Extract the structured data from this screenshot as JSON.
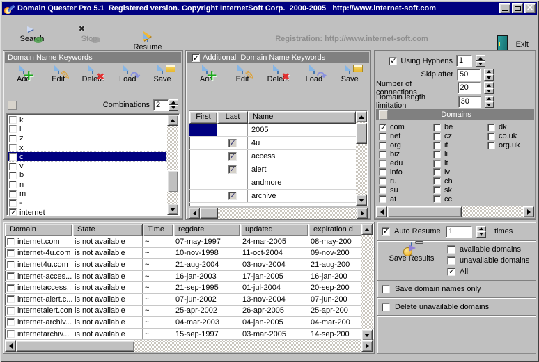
{
  "titlebar": {
    "title": "Domain Quester Pro 5.1  Registered version. Copyright InternetSoft Corp.  2000-2005   http://www.internet-soft.com"
  },
  "toolbar": {
    "search": "Search",
    "stop": "Stop",
    "resume": "Resume",
    "registration": "Registration: http://www.internet-soft.com",
    "exit": "Exit"
  },
  "keywords_panel": {
    "title": "Domain Name Keywords",
    "buttons": [
      {
        "label": "Add",
        "icon": "add-icon"
      },
      {
        "label": "Edit",
        "icon": "edit-icon"
      },
      {
        "label": "Delete",
        "icon": "delete-icon"
      },
      {
        "label": "Load",
        "icon": "load-icon"
      },
      {
        "label": "Save",
        "icon": "save-icon"
      }
    ],
    "combinations_label": "Combinations",
    "combinations_value": "2",
    "items": [
      {
        "label": "k"
      },
      {
        "label": "l"
      },
      {
        "label": "z"
      },
      {
        "label": "x"
      },
      {
        "label": "c",
        "selected": true
      },
      {
        "label": "v"
      },
      {
        "label": "b"
      },
      {
        "label": "n"
      },
      {
        "label": "m"
      },
      {
        "label": "-"
      },
      {
        "label": "internet",
        "checked": true
      }
    ]
  },
  "additional_panel": {
    "title": "Additional  Domain Name Keywords",
    "enabled": true,
    "buttons": [
      {
        "label": "Add",
        "icon": "add-icon"
      },
      {
        "label": "Edit",
        "icon": "edit-icon"
      },
      {
        "label": "Delete",
        "icon": "delete-icon"
      },
      {
        "label": "Load",
        "icon": "load-icon"
      },
      {
        "label": "Save",
        "icon": "save-icon"
      }
    ],
    "columns": [
      "First",
      "Last",
      "Name"
    ],
    "rows": [
      {
        "name": "2005",
        "first_selected": true,
        "last_checked": false
      },
      {
        "name": "4u",
        "last_checked": true
      },
      {
        "name": "access",
        "last_checked": true
      },
      {
        "name": "alert",
        "last_checked": true
      },
      {
        "name": "andmore",
        "last_checked": false
      },
      {
        "name": "archive",
        "last_checked": true
      }
    ]
  },
  "settings_panel": {
    "rows": [
      {
        "label": "Using Hyphens",
        "value": "1",
        "has_checkbox": true,
        "checked": true,
        "narrow": true
      },
      {
        "label": "Skip after",
        "value": "50"
      },
      {
        "label": "Number of connections",
        "value": "20"
      },
      {
        "label": "Domain length limitation",
        "value": "30"
      }
    ],
    "domains_title": "Domains",
    "domain_columns_1": [
      {
        "label": "com",
        "checked": true
      },
      {
        "label": "net"
      },
      {
        "label": "org"
      },
      {
        "label": "biz"
      },
      {
        "label": "edu"
      },
      {
        "label": "info"
      },
      {
        "label": "ru"
      },
      {
        "label": "su"
      },
      {
        "label": "at"
      }
    ],
    "domain_columns_2": [
      {
        "label": "be"
      },
      {
        "label": "cz"
      },
      {
        "label": "it"
      },
      {
        "label": "li"
      },
      {
        "label": "lt"
      },
      {
        "label": "lv"
      },
      {
        "label": "ch"
      },
      {
        "label": "sk"
      },
      {
        "label": "cc"
      }
    ],
    "domain_columns_3": [
      {
        "label": "dk"
      },
      {
        "label": "co.uk"
      },
      {
        "label": "org.uk"
      }
    ]
  },
  "results_table": {
    "headers": [
      "Domain",
      "State",
      "Time",
      "regdate",
      "updated",
      "expiration d"
    ],
    "rows": [
      {
        "domain": "internet.com",
        "state": "is not available",
        "time": "~",
        "regdate": "07-may-1997",
        "updated": "24-mar-2005",
        "expiration": "08-may-200"
      },
      {
        "domain": "internet-4u.com",
        "state": "is not available",
        "time": "~",
        "regdate": "10-nov-1998",
        "updated": "11-oct-2004",
        "expiration": "09-nov-200"
      },
      {
        "domain": "internet4u.com",
        "state": "is not available",
        "time": "~",
        "regdate": "21-aug-2004",
        "updated": "03-nov-2004",
        "expiration": "21-aug-200"
      },
      {
        "domain": "internet-acces...",
        "state": "is not available",
        "time": "~",
        "regdate": "16-jan-2003",
        "updated": "17-jan-2005",
        "expiration": "16-jan-200"
      },
      {
        "domain": "internetaccess...",
        "state": "is not available",
        "time": "~",
        "regdate": "21-sep-1995",
        "updated": "01-jul-2004",
        "expiration": "20-sep-200"
      },
      {
        "domain": "internet-alert.c...",
        "state": "is not available",
        "time": "~",
        "regdate": "07-jun-2002",
        "updated": "13-nov-2004",
        "expiration": "07-jun-200"
      },
      {
        "domain": "internetalert.com",
        "state": "is not available",
        "time": "~",
        "regdate": "25-apr-2002",
        "updated": "26-apr-2005",
        "expiration": "25-apr-200"
      },
      {
        "domain": "internet-archiv...",
        "state": "is not available",
        "time": "~",
        "regdate": "04-mar-2003",
        "updated": "04-jan-2005",
        "expiration": "04-mar-200"
      },
      {
        "domain": "internetarchiv...",
        "state": "is not available",
        "time": "~",
        "regdate": "15-sep-1997",
        "updated": "03-mar-2005",
        "expiration": "14-sep-200"
      }
    ]
  },
  "options_panel": {
    "auto_resume_label": "Auto Resume",
    "auto_resume_checked": true,
    "auto_resume_value": "1",
    "times_label": "times",
    "save_results_label": "Save Results",
    "filters": [
      {
        "label": "available domains"
      },
      {
        "label": "unavailable domains"
      },
      {
        "label": "All",
        "checked": true
      }
    ],
    "save_names_label": "Save domain names only",
    "delete_label": "Delete unavailable domains"
  },
  "colors": {
    "titlebar": "#000080",
    "panel": "#c0c0c0",
    "header_bar": "#808080",
    "selection": "#000080"
  }
}
